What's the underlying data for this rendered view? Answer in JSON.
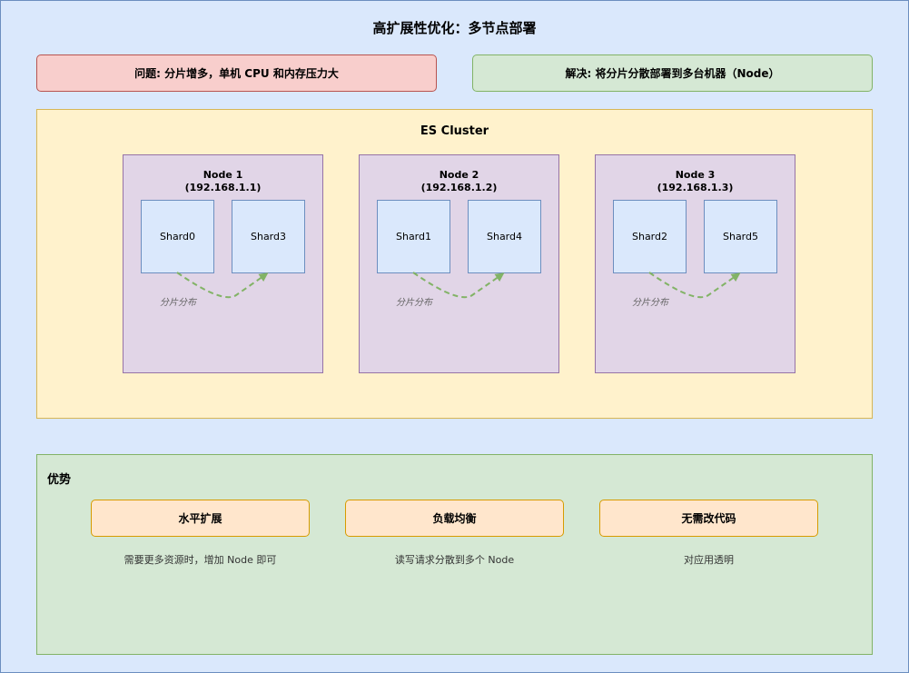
{
  "title": "高扩展性优化：多节点部署",
  "problem": "问题: 分片增多，单机 CPU 和内存压力大",
  "solution": "解决: 将分片分散部署到多台机器（Node）",
  "cluster": {
    "title": "ES Cluster",
    "nodes": [
      {
        "name": "Node 1",
        "ip": "(192.168.1.1)",
        "shards": [
          "Shard0",
          "Shard3"
        ],
        "label": "分片分布"
      },
      {
        "name": "Node 2",
        "ip": "(192.168.1.2)",
        "shards": [
          "Shard1",
          "Shard4"
        ],
        "label": "分片分布"
      },
      {
        "name": "Node 3",
        "ip": "(192.168.1.3)",
        "shards": [
          "Shard2",
          "Shard5"
        ],
        "label": "分片分布"
      }
    ]
  },
  "advantages": {
    "title": "优势",
    "items": [
      {
        "label": "水平扩展",
        "desc": "需要更多资源时，增加 Node 即可"
      },
      {
        "label": "负载均衡",
        "desc": "读写请求分散到多个 Node"
      },
      {
        "label": "无需改代码",
        "desc": "对应用透明"
      }
    ]
  },
  "colors": {
    "background": "#dae8fc",
    "problem": "#f8cecc",
    "solution": "#d5e8d4",
    "cluster": "#fff2cc",
    "node": "#e1d5e7",
    "shard": "#dae8fc",
    "advantage": "#ffe6cc",
    "arrow": "#82b366"
  }
}
